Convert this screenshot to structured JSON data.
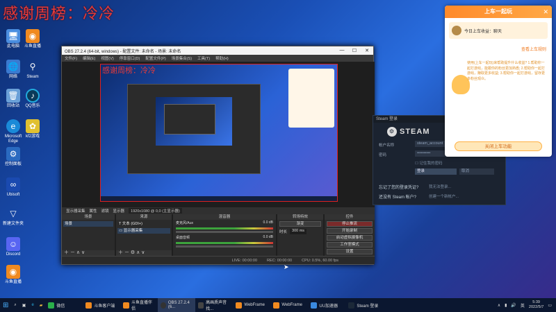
{
  "overlay_title": "感谢周榜：冷冷",
  "desktop_icons": [
    "此电脑",
    "斗鱼直播",
    "网络",
    "Steam",
    "回收站",
    "QQ音乐",
    "Microsoft Edge",
    "kf2游戏",
    "控制面板",
    "Ubisoft",
    "新建文件夹",
    "Discord",
    "斗鱼直播"
  ],
  "obs": {
    "title": "OBS 27.2.4 (64-bit, windows) - 配置文件: 未命名 - 场景: 未命名",
    "menu": [
      "文件(F)",
      "编辑(E)",
      "视图(V)",
      "停靠窗口(D)",
      "配置文件(P)",
      "场景集合(S)",
      "工具(T)",
      "帮助(H)"
    ],
    "canvas_title": "感谢周榜：冷冷",
    "source_bar": [
      "显示器采集",
      "属性",
      "滤镜",
      "显示器",
      "1920x1080 @ 0,0 (主显示器)"
    ],
    "docks": {
      "scenes": {
        "header": "场景",
        "item": "场景"
      },
      "sources": {
        "header": "来源",
        "items": [
          "文本 (GDI+)",
          "显示器采集"
        ]
      },
      "mixer": {
        "header": "混音器",
        "ch1": "麦克风/Aux",
        "ch2": "桌面音频",
        "db1": "0.0 dB",
        "db2": "0.0 dB"
      },
      "transitions": {
        "header": "转场特效",
        "type": "渐变",
        "duration_label": "时长",
        "duration": "300 ms"
      },
      "controls": {
        "header": "控件",
        "buttons": [
          "停止推流",
          "开始录制",
          "启动虚拟摄像机",
          "工作室模式",
          "设置",
          "退出"
        ]
      }
    },
    "status": {
      "live": "LIVE: 00:00:00",
      "rec": "REC: 00:00:00",
      "cpu": "CPU: 0.5%, 60.00 fps"
    }
  },
  "steam": {
    "window_title": "Steam 登录",
    "logo": "STEAM",
    "account_label": "帐户名称",
    "account_value": "steam_account",
    "password_label": "密码",
    "password_value": "••••••••••",
    "remember": "记住我的密码",
    "login_btn": "登录",
    "cancel_btn": "取消",
    "forgot": "忘记了您的登录凭证?",
    "forgot_link": "我无法登录...",
    "no_account": "还没有 Steam 帐户?",
    "create": "创建一个新帐户..."
  },
  "promo": {
    "header": "上车一起玩",
    "today": "今日上车收益：聊天",
    "link": "查看上车规则",
    "text": "使用(上车一起玩)来帮助提升什么收益? 1.帮助你一起打游戏，能跟你的粉丝更加熟悉; 2.帮助你一起打游戏，赚取更多收益; 3.帮助你一起打游戏，留存更多粉丝观众。",
    "button": "关闭上车功能"
  },
  "taskbar": {
    "items": [
      "微信",
      "斗鱼客户端",
      "斗鱼直播伴侣",
      "OBS 27.2.4 (6...",
      "高画质声音找...",
      "WebFrame",
      "WebFrame",
      "UU加速器",
      "Steam 登录"
    ],
    "time": "5:39",
    "date": "2022/5/7"
  }
}
